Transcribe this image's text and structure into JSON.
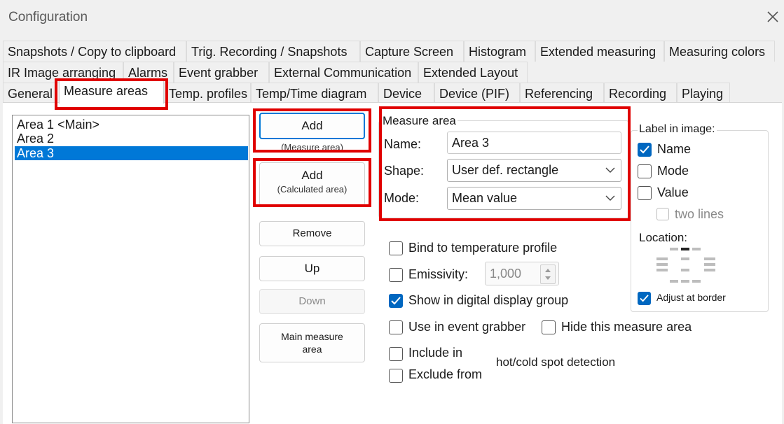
{
  "window": {
    "title": "Configuration",
    "close_icon": "close-icon"
  },
  "tabs_row1": [
    "Snapshots / Copy to clipboard",
    "Trig. Recording / Snapshots",
    "Capture Screen",
    "Histogram",
    "Extended measuring",
    "Measuring colors"
  ],
  "tabs_row2": [
    "IR Image arranging",
    "Alarms",
    "Event grabber",
    "External Communication",
    "Extended Layout"
  ],
  "tabs_row3": [
    "General",
    "Measure areas",
    "Temp. profiles",
    "Temp/Time diagram",
    "Device",
    "Device (PIF)",
    "Referencing",
    "Recording",
    "Playing"
  ],
  "selected_tab": "Measure areas",
  "areas": [
    "Area 1 <Main>",
    "Area 2",
    "Area 3"
  ],
  "selected_area": "Area 3",
  "buttons": {
    "add_measure": {
      "label": "Add",
      "sub": "(Measure area)"
    },
    "add_calculated": {
      "label": "Add",
      "sub": "(Calculated area)"
    },
    "remove": "Remove",
    "up": "Up",
    "down": "Down",
    "main_measure_line1": "Main measure",
    "main_measure_line2": "area"
  },
  "measure_area": {
    "group_label": "Measure area",
    "name_label": "Name:",
    "name_value": "Area 3",
    "shape_label": "Shape:",
    "shape_value": "User def. rectangle",
    "mode_label": "Mode:",
    "mode_value": "Mean value"
  },
  "label_in_image": {
    "group_label": "Label in image:",
    "name": {
      "label": "Name",
      "checked": true
    },
    "mode": {
      "label": "Mode",
      "checked": false
    },
    "value": {
      "label": "Value",
      "checked": false
    },
    "two_lines": {
      "label": "two lines",
      "checked": false,
      "disabled": true
    },
    "location_label": "Location:",
    "adjust": {
      "label": "Adjust at border",
      "checked": true
    }
  },
  "options": {
    "bind": "Bind to temperature profile",
    "emissivity_label": "Emissivity:",
    "emissivity_value": "1,000",
    "show_digital": "Show in digital display group",
    "event_grabber": "Use in event grabber",
    "hide_area": "Hide this measure area",
    "include_in": "Include in",
    "exclude_from": "Exclude from",
    "hotcold": "hot/cold spot detection"
  },
  "colors": {
    "accent": "#0078d7",
    "check": "#0067c0",
    "highlight": "#e00000"
  }
}
